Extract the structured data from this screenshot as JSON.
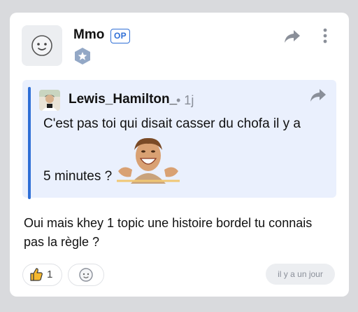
{
  "post": {
    "author": "Mmo",
    "op_badge": "OP",
    "body": "Oui mais khey 1 topic une histoire bordel tu connais pas la règle ?",
    "timestamp": "il y a un jour",
    "like_count": "1",
    "icons": {
      "avatar": "smiley-face-icon",
      "rank": "star-hexagon-icon",
      "share": "share-arrow-icon",
      "menu": "vertical-dots-icon",
      "like": "thumbs-up-icon",
      "react": "smiley-face-icon"
    }
  },
  "quote": {
    "author": "Lewis_Hamilton_",
    "time": "• 1j",
    "line1": "C'est pas toi qui disait casser du chofa il y a",
    "line2": "5 minutes ?",
    "sticker": "laughing-man-sticker"
  },
  "colors": {
    "accent": "#2f6fd6",
    "quote_bg": "#eaf0fd",
    "like_icon": "#f5b82e",
    "background": "#d9dadd"
  }
}
